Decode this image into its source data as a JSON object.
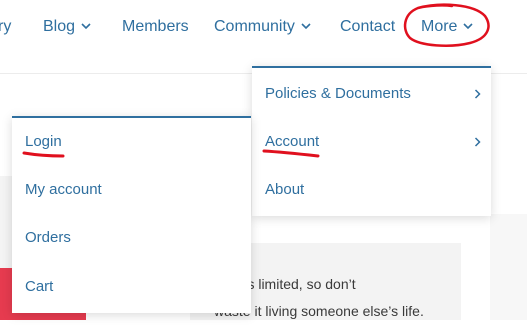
{
  "nav": {
    "items": [
      {
        "label": "ry"
      },
      {
        "label": "Blog"
      },
      {
        "label": "Members"
      },
      {
        "label": "Community"
      },
      {
        "label": "Contact"
      },
      {
        "label": "More"
      }
    ]
  },
  "more_menu": {
    "items": [
      {
        "label": "Policies & Documents"
      },
      {
        "label": "Account"
      },
      {
        "label": "About"
      }
    ]
  },
  "account_menu": {
    "items": [
      {
        "label": "Login"
      },
      {
        "label": "My account"
      },
      {
        "label": "Orders"
      },
      {
        "label": "Cart"
      }
    ]
  },
  "quote": {
    "line1": "time is limited, so don’t",
    "line2": "waste it living someone else’s life."
  },
  "colors": {
    "link": "#2f6f9f",
    "annotation": "#e0101e",
    "accent_red": "#e63b4f"
  },
  "icons": [
    "chevron-down-icon",
    "chevron-right-icon"
  ]
}
